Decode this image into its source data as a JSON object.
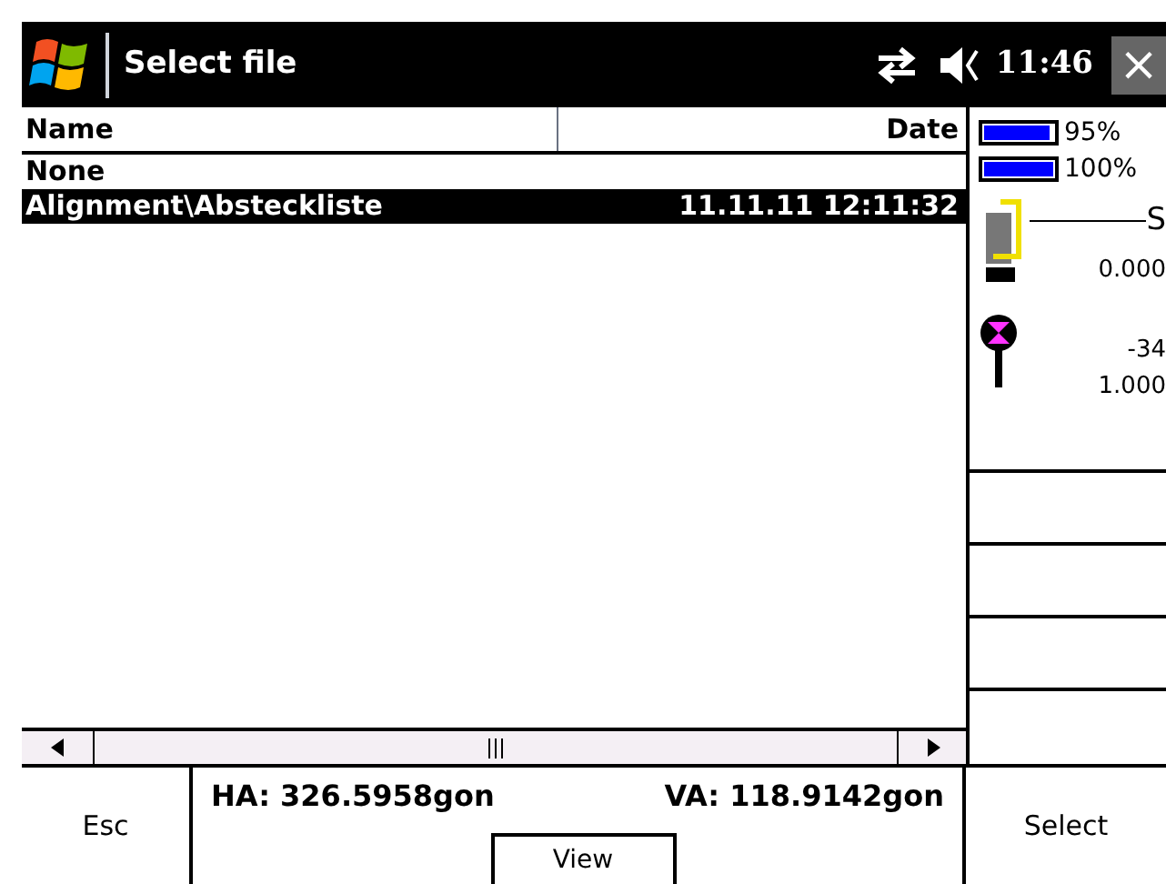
{
  "window": {
    "title": "Select file",
    "time": "11:46",
    "close": "×"
  },
  "table": {
    "columns": [
      "Name",
      "Date"
    ],
    "rows": [
      {
        "name": "None",
        "date": "",
        "selected": false
      },
      {
        "name": "Alignment\\Absteckliste",
        "date": "11.11.11 12:11:32",
        "selected": true
      }
    ]
  },
  "status_panel": {
    "batteries": [
      {
        "reading": "95%",
        "level": 0.95
      },
      {
        "reading": "100%",
        "level": 1.0
      }
    ],
    "instrument": {
      "label": "S",
      "reading": "0.000"
    },
    "prism": {
      "reading_1": "-34",
      "reading_2": "1.000"
    }
  },
  "footer": {
    "esc": "Esc",
    "ha": "HA: 326.5958gon",
    "va": "VA: 118.9142gon",
    "view": "View",
    "select": "Select"
  }
}
